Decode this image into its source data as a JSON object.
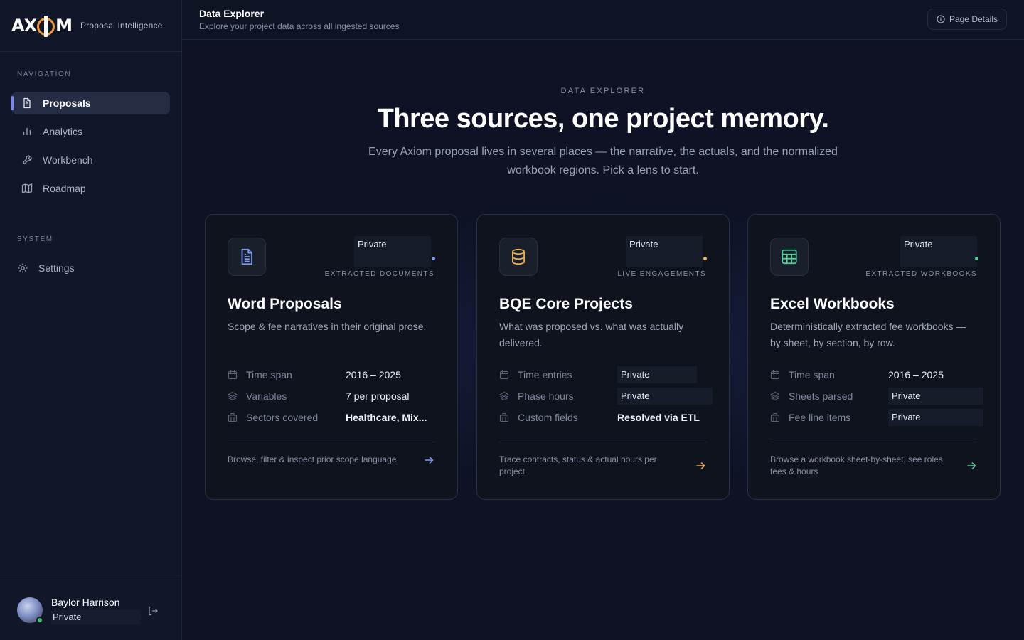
{
  "app": {
    "logo_text_left": "AX",
    "logo_text_right": "M",
    "subtitle": "Proposal Intelligence"
  },
  "sidebar": {
    "navigation_label": "NAVIGATION",
    "items": [
      {
        "label": "Proposals",
        "icon": "document-icon",
        "active": true
      },
      {
        "label": "Analytics",
        "icon": "bar-chart-icon",
        "active": false
      },
      {
        "label": "Workbench",
        "icon": "wrench-icon",
        "active": false
      },
      {
        "label": "Roadmap",
        "icon": "map-icon",
        "active": false
      }
    ],
    "system_label": "SYSTEM",
    "settings_label": "Settings",
    "user": {
      "name": "Baylor Harrison",
      "role": "Private"
    }
  },
  "topbar": {
    "title": "Data Explorer",
    "subtitle": "Explore your project data across all ingested sources",
    "page_details_label": "Page Details"
  },
  "hero": {
    "eyebrow": "DATA EXPLORER",
    "title": "Three sources, one project memory.",
    "description": "Every Axiom proposal lives in several places — the narrative, the actuals, and the normalized workbook regions. Pick a lens to start."
  },
  "cards": [
    {
      "badge": "Private",
      "kind": "EXTRACTED DOCUMENTS",
      "title": "Word Proposals",
      "description": "Scope & fee narratives in their original prose.",
      "accent": "#7b9cf0",
      "stats": [
        {
          "label": "Time span",
          "value": "2016 – 2025"
        },
        {
          "label": "Variables",
          "value": "7 per proposal"
        },
        {
          "label": "Sectors covered",
          "value": "Healthcare, Mix..."
        }
      ],
      "footer": "Browse, filter & inspect prior scope language"
    },
    {
      "badge": "Private",
      "kind": "LIVE ENGAGEMENTS",
      "title": "BQE Core Projects",
      "description": "What was proposed vs. what was actually delivered.",
      "accent": "#f0b24a",
      "stats": [
        {
          "label": "Time entries",
          "value": "Private"
        },
        {
          "label": "Phase hours",
          "value": "Private"
        },
        {
          "label": "Custom fields",
          "value": "Resolved via ETL"
        }
      ],
      "footer": "Trace contracts, status & actual hours per project"
    },
    {
      "badge": "Private",
      "kind": "EXTRACTED WORKBOOKS",
      "title": "Excel Workbooks",
      "description": "Deterministically extracted fee workbooks — by sheet, by section, by row.",
      "accent": "#4fd49a",
      "stats": [
        {
          "label": "Time span",
          "value": "2016 – 2025"
        },
        {
          "label": "Sheets parsed",
          "value": "Private"
        },
        {
          "label": "Fee line items",
          "value": "Private"
        }
      ],
      "footer": "Browse a workbook sheet-by-sheet, see roles, fees & hours"
    }
  ]
}
